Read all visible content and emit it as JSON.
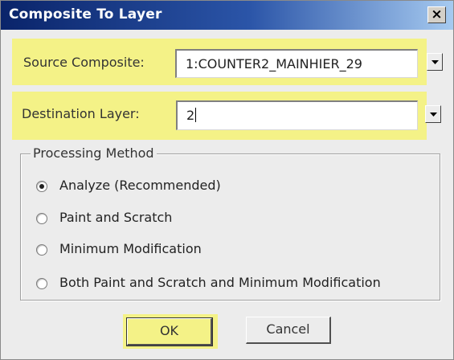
{
  "window": {
    "title": "Composite To Layer",
    "close_label": "×"
  },
  "source_composite": {
    "label": "Source Composite:",
    "value": "1:COUNTER2_MAINHIER_29"
  },
  "destination_layer": {
    "label": "Destination Layer:",
    "value": "2"
  },
  "processing_method": {
    "title": "Processing Method",
    "options": [
      {
        "label": "Analyze (Recommended)",
        "selected": true
      },
      {
        "label": "Paint and Scratch",
        "selected": false
      },
      {
        "label": "Minimum Modification",
        "selected": false
      },
      {
        "label": "Both Paint and Scratch and Minimum Modification",
        "selected": false
      }
    ]
  },
  "buttons": {
    "ok_label": "OK",
    "cancel_label": "Cancel"
  },
  "colors": {
    "titlebar_start": "#0a246a",
    "titlebar_end": "#a6caf0",
    "highlight": "#f6f36a",
    "dialog_bg": "#ececec"
  },
  "icons": {
    "close": "close-icon",
    "dropdown": "chevron-down-icon",
    "radio": "radio-button"
  }
}
